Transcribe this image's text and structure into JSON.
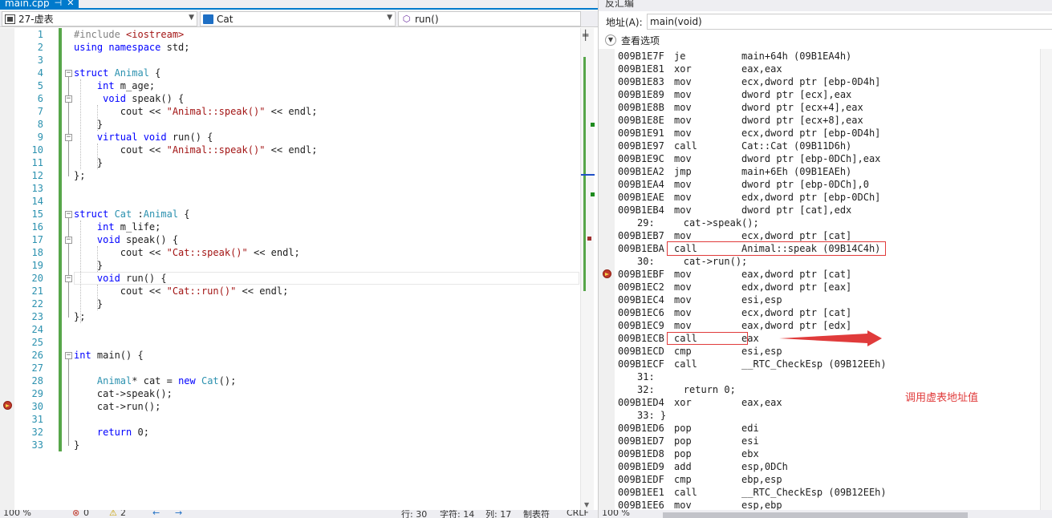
{
  "editor": {
    "tab_label": "main.cpp",
    "tab_pin": "⊣",
    "tab_close": "✕",
    "nav": {
      "scope": "27-虚表",
      "class": "Cat",
      "method": "run()"
    },
    "split_icon": "split-window-icon",
    "lines": [
      {
        "n": "1",
        "tokens": [
          {
            "t": "#include ",
            "c": "pp"
          },
          {
            "t": "<iostream>",
            "c": "st"
          }
        ]
      },
      {
        "n": "2",
        "tokens": [
          {
            "t": "using ",
            "c": "kw"
          },
          {
            "t": "namespace ",
            "c": "kw"
          },
          {
            "t": "std;",
            "c": ""
          }
        ]
      },
      {
        "n": "3",
        "tokens": []
      },
      {
        "n": "4",
        "tokens": [
          {
            "t": "struct ",
            "c": "kw"
          },
          {
            "t": "Animal",
            "c": "ty"
          },
          {
            "t": " {",
            "c": ""
          }
        ]
      },
      {
        "n": "5",
        "tokens": [
          {
            "t": "    int ",
            "c": "kw"
          },
          {
            "t": "m_age;",
            "c": ""
          }
        ]
      },
      {
        "n": "6",
        "tokens": [
          {
            "t": "     void ",
            "c": "kw"
          },
          {
            "t": "speak() {",
            "c": ""
          }
        ]
      },
      {
        "n": "7",
        "tokens": [
          {
            "t": "        cout << ",
            "c": ""
          },
          {
            "t": "\"Animal::speak()\"",
            "c": "st"
          },
          {
            "t": " << endl;",
            "c": ""
          }
        ]
      },
      {
        "n": "8",
        "tokens": [
          {
            "t": "    }",
            "c": ""
          }
        ]
      },
      {
        "n": "9",
        "tokens": [
          {
            "t": "    virtual ",
            "c": "kw"
          },
          {
            "t": "void ",
            "c": "kw"
          },
          {
            "t": "run() {",
            "c": ""
          }
        ]
      },
      {
        "n": "10",
        "tokens": [
          {
            "t": "        cout << ",
            "c": ""
          },
          {
            "t": "\"Animal::speak()\"",
            "c": "st"
          },
          {
            "t": " << endl;",
            "c": ""
          }
        ]
      },
      {
        "n": "11",
        "tokens": [
          {
            "t": "    }",
            "c": ""
          }
        ]
      },
      {
        "n": "12",
        "tokens": [
          {
            "t": "};",
            "c": ""
          }
        ]
      },
      {
        "n": "13",
        "tokens": []
      },
      {
        "n": "14",
        "tokens": []
      },
      {
        "n": "15",
        "tokens": [
          {
            "t": "struct ",
            "c": "kw"
          },
          {
            "t": "Cat",
            "c": "ty"
          },
          {
            "t": " :",
            "c": ""
          },
          {
            "t": "Animal",
            "c": "ty"
          },
          {
            "t": " {",
            "c": ""
          }
        ]
      },
      {
        "n": "16",
        "tokens": [
          {
            "t": "    int ",
            "c": "kw"
          },
          {
            "t": "m_life;",
            "c": ""
          }
        ]
      },
      {
        "n": "17",
        "tokens": [
          {
            "t": "    void ",
            "c": "kw"
          },
          {
            "t": "speak() {",
            "c": ""
          }
        ]
      },
      {
        "n": "18",
        "tokens": [
          {
            "t": "        cout << ",
            "c": ""
          },
          {
            "t": "\"Cat::speak()\"",
            "c": "st"
          },
          {
            "t": " << endl;",
            "c": ""
          }
        ]
      },
      {
        "n": "19",
        "tokens": [
          {
            "t": "    }",
            "c": ""
          }
        ]
      },
      {
        "n": "20",
        "tokens": [
          {
            "t": "    void ",
            "c": "kw"
          },
          {
            "t": "run() {",
            "c": ""
          }
        ]
      },
      {
        "n": "21",
        "tokens": [
          {
            "t": "        cout << ",
            "c": ""
          },
          {
            "t": "\"Cat::run()\"",
            "c": "st"
          },
          {
            "t": " << endl;",
            "c": ""
          }
        ]
      },
      {
        "n": "22",
        "tokens": [
          {
            "t": "    }",
            "c": ""
          }
        ]
      },
      {
        "n": "23",
        "tokens": [
          {
            "t": "};",
            "c": ""
          }
        ]
      },
      {
        "n": "24",
        "tokens": []
      },
      {
        "n": "25",
        "tokens": []
      },
      {
        "n": "26",
        "tokens": [
          {
            "t": "int ",
            "c": "kw"
          },
          {
            "t": "main() {",
            "c": ""
          }
        ]
      },
      {
        "n": "27",
        "tokens": []
      },
      {
        "n": "28",
        "tokens": [
          {
            "t": "    ",
            "c": ""
          },
          {
            "t": "Animal",
            "c": "ty"
          },
          {
            "t": "* cat = ",
            "c": ""
          },
          {
            "t": "new ",
            "c": "kw"
          },
          {
            "t": "Cat",
            "c": "ty"
          },
          {
            "t": "();",
            "c": ""
          }
        ]
      },
      {
        "n": "29",
        "tokens": [
          {
            "t": "    cat->speak();",
            "c": ""
          }
        ]
      },
      {
        "n": "30",
        "tokens": [
          {
            "t": "    cat->run();",
            "c": ""
          }
        ]
      },
      {
        "n": "31",
        "tokens": []
      },
      {
        "n": "32",
        "tokens": [
          {
            "t": "    return ",
            "c": "kw"
          },
          {
            "t": "0;",
            "c": ""
          }
        ]
      },
      {
        "n": "33",
        "tokens": [
          {
            "t": "}",
            "c": ""
          }
        ]
      }
    ],
    "status": {
      "zoom": "100 %",
      "errors": "0",
      "warnings": "2",
      "line": "行: 30",
      "char": "字符: 14",
      "col": "列: 17",
      "tabs": "制表符",
      "eol": "CRLF"
    }
  },
  "disasm": {
    "title": "反汇编",
    "address_label": "地址(A):",
    "address_value": "main(void)",
    "options_label": "查看选项",
    "rows": [
      {
        "type": "asm",
        "addr": "009B1E7F",
        "mn": "je",
        "op": "main+64h (09B1EA4h)"
      },
      {
        "type": "asm",
        "addr": "009B1E81",
        "mn": "xor",
        "op": "eax,eax"
      },
      {
        "type": "asm",
        "addr": "009B1E83",
        "mn": "mov",
        "op": "ecx,dword ptr [ebp-0D4h]"
      },
      {
        "type": "asm",
        "addr": "009B1E89",
        "mn": "mov",
        "op": "dword ptr [ecx],eax"
      },
      {
        "type": "asm",
        "addr": "009B1E8B",
        "mn": "mov",
        "op": "dword ptr [ecx+4],eax"
      },
      {
        "type": "asm",
        "addr": "009B1E8E",
        "mn": "mov",
        "op": "dword ptr [ecx+8],eax"
      },
      {
        "type": "asm",
        "addr": "009B1E91",
        "mn": "mov",
        "op": "ecx,dword ptr [ebp-0D4h]"
      },
      {
        "type": "asm",
        "addr": "009B1E97",
        "mn": "call",
        "op": "Cat::Cat (09B11D6h)"
      },
      {
        "type": "asm",
        "addr": "009B1E9C",
        "mn": "mov",
        "op": "dword ptr [ebp-0DCh],eax"
      },
      {
        "type": "asm",
        "addr": "009B1EA2",
        "mn": "jmp",
        "op": "main+6Eh (09B1EAEh)"
      },
      {
        "type": "asm",
        "addr": "009B1EA4",
        "mn": "mov",
        "op": "dword ptr [ebp-0DCh],0"
      },
      {
        "type": "asm",
        "addr": "009B1EAE",
        "mn": "mov",
        "op": "edx,dword ptr [ebp-0DCh]"
      },
      {
        "type": "asm",
        "addr": "009B1EB4",
        "mn": "mov",
        "op": "dword ptr [cat],edx"
      },
      {
        "type": "src",
        "text": "29:     cat->speak();"
      },
      {
        "type": "asm",
        "addr": "009B1EB7",
        "mn": "mov",
        "op": "ecx,dword ptr [cat]"
      },
      {
        "type": "asm",
        "addr": "009B1EBA",
        "mn": "call",
        "op": "Animal::speak (09B14C4h)"
      },
      {
        "type": "src",
        "text": "30:     cat->run();"
      },
      {
        "type": "asm",
        "addr": "009B1EBF",
        "mn": "mov",
        "op": "eax,dword ptr [cat]"
      },
      {
        "type": "asm",
        "addr": "009B1EC2",
        "mn": "mov",
        "op": "edx,dword ptr [eax]"
      },
      {
        "type": "asm",
        "addr": "009B1EC4",
        "mn": "mov",
        "op": "esi,esp"
      },
      {
        "type": "asm",
        "addr": "009B1EC6",
        "mn": "mov",
        "op": "ecx,dword ptr [cat]"
      },
      {
        "type": "asm",
        "addr": "009B1EC9",
        "mn": "mov",
        "op": "eax,dword ptr [edx]"
      },
      {
        "type": "asm",
        "addr": "009B1ECB",
        "mn": "call",
        "op": "eax"
      },
      {
        "type": "asm",
        "addr": "009B1ECD",
        "mn": "cmp",
        "op": "esi,esp"
      },
      {
        "type": "asm",
        "addr": "009B1ECF",
        "mn": "call",
        "op": "__RTC_CheckEsp (09B12EEh)"
      },
      {
        "type": "src",
        "text": "31:"
      },
      {
        "type": "src",
        "text": "32:     return 0;"
      },
      {
        "type": "asm",
        "addr": "009B1ED4",
        "mn": "xor",
        "op": "eax,eax"
      },
      {
        "type": "src",
        "text": "33: }"
      },
      {
        "type": "asm",
        "addr": "009B1ED6",
        "mn": "pop",
        "op": "edi"
      },
      {
        "type": "asm",
        "addr": "009B1ED7",
        "mn": "pop",
        "op": "esi"
      },
      {
        "type": "asm",
        "addr": "009B1ED8",
        "mn": "pop",
        "op": "ebx"
      },
      {
        "type": "asm",
        "addr": "009B1ED9",
        "mn": "add",
        "op": "esp,0DCh"
      },
      {
        "type": "asm",
        "addr": "009B1EDF",
        "mn": "cmp",
        "op": "ebp,esp"
      },
      {
        "type": "asm",
        "addr": "009B1EE1",
        "mn": "call",
        "op": "__RTC_CheckEsp (09B12EEh)"
      },
      {
        "type": "asm",
        "addr": "009B1EE6",
        "mn": "mov",
        "op": "esp,ebp"
      }
    ],
    "annotation": "调用虚表地址值",
    "status_zoom": "100 %",
    "colors": {
      "annotation": "#e03b3b",
      "accent": "#007acc"
    }
  }
}
